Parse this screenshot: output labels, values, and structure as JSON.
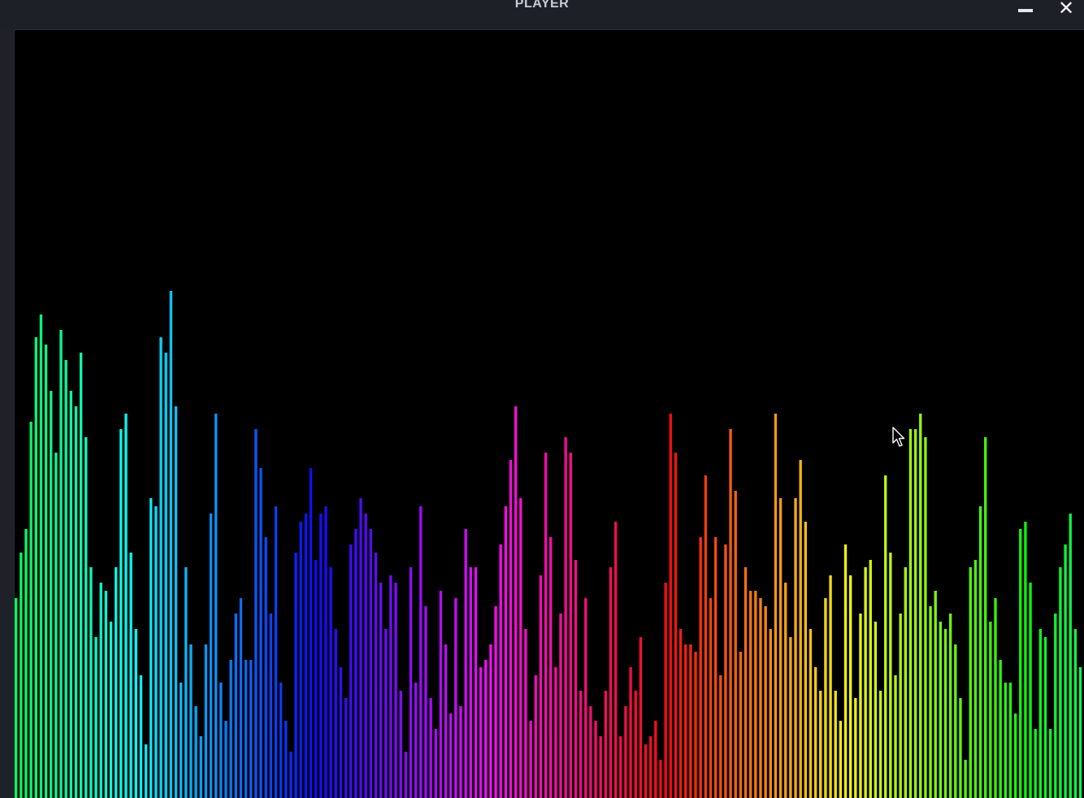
{
  "window": {
    "title": "PLAYER",
    "minimize_icon": "minimize-icon",
    "close_icon": "close-icon",
    "close_glyph": "✕"
  },
  "colors": {
    "titlebar": "#1e2028",
    "frame": "#1f2129",
    "viz_background": "#000000",
    "title_text": "#c9ccd4"
  },
  "visualizer": {
    "levels": [
      0.26,
      0.32,
      0.35,
      0.49,
      0.6,
      0.63,
      0.59,
      0.53,
      0.45,
      0.61,
      0.57,
      0.53,
      0.51,
      0.58,
      0.47,
      0.3,
      0.21,
      0.28,
      0.27,
      0.23,
      0.3,
      0.48,
      0.5,
      0.32,
      0.22,
      0.16,
      0.07,
      0.39,
      0.38,
      0.6,
      0.58,
      0.66,
      0.51,
      0.15,
      0.3,
      0.2,
      0.12,
      0.08,
      0.2,
      0.37,
      0.5,
      0.15,
      0.1,
      0.18,
      0.24,
      0.26,
      0.18,
      0.18,
      0.48,
      0.43,
      0.34,
      0.24,
      0.38,
      0.15,
      0.1,
      0.06,
      0.32,
      0.36,
      0.37,
      0.43,
      0.31,
      0.37,
      0.38,
      0.3,
      0.22,
      0.17,
      0.13,
      0.33,
      0.35,
      0.39,
      0.37,
      0.35,
      0.32,
      0.28,
      0.22,
      0.29,
      0.28,
      0.14,
      0.06,
      0.3,
      0.15,
      0.38,
      0.25,
      0.13,
      0.09,
      0.27,
      0.2,
      0.11,
      0.26,
      0.12,
      0.35,
      0.3,
      0.3,
      0.17,
      0.18,
      0.2,
      0.25,
      0.33,
      0.38,
      0.44,
      0.51,
      0.39,
      0.22,
      0.1,
      0.16,
      0.29,
      0.45,
      0.34,
      0.17,
      0.24,
      0.47,
      0.45,
      0.31,
      0.14,
      0.26,
      0.12,
      0.1,
      0.08,
      0.14,
      0.3,
      0.36,
      0.08,
      0.12,
      0.17,
      0.14,
      0.21,
      0.07,
      0.08,
      0.1,
      0.05,
      0.28,
      0.5,
      0.45,
      0.22,
      0.2,
      0.2,
      0.19,
      0.34,
      0.42,
      0.26,
      0.34,
      0.16,
      0.33,
      0.48,
      0.4,
      0.19,
      0.3,
      0.27,
      0.27,
      0.26,
      0.25,
      0.22,
      0.5,
      0.39,
      0.28,
      0.21,
      0.39,
      0.44,
      0.36,
      0.22,
      0.17,
      0.14,
      0.26,
      0.29,
      0.14,
      0.1,
      0.33,
      0.29,
      0.13,
      0.24,
      0.3,
      0.31,
      0.23,
      0.14,
      0.42,
      0.32,
      0.16,
      0.24,
      0.3,
      0.48,
      0.48,
      0.5,
      0.47,
      0.25,
      0.27,
      0.23,
      0.22,
      0.24,
      0.2,
      0.13,
      0.05,
      0.3,
      0.31,
      0.38,
      0.47,
      0.23,
      0.26,
      0.18,
      0.15,
      0.15,
      0.11,
      0.35,
      0.36,
      0.28,
      0.09,
      0.22,
      0.21,
      0.09,
      0.24,
      0.3,
      0.33,
      0.37,
      0.22,
      0.17
    ]
  }
}
